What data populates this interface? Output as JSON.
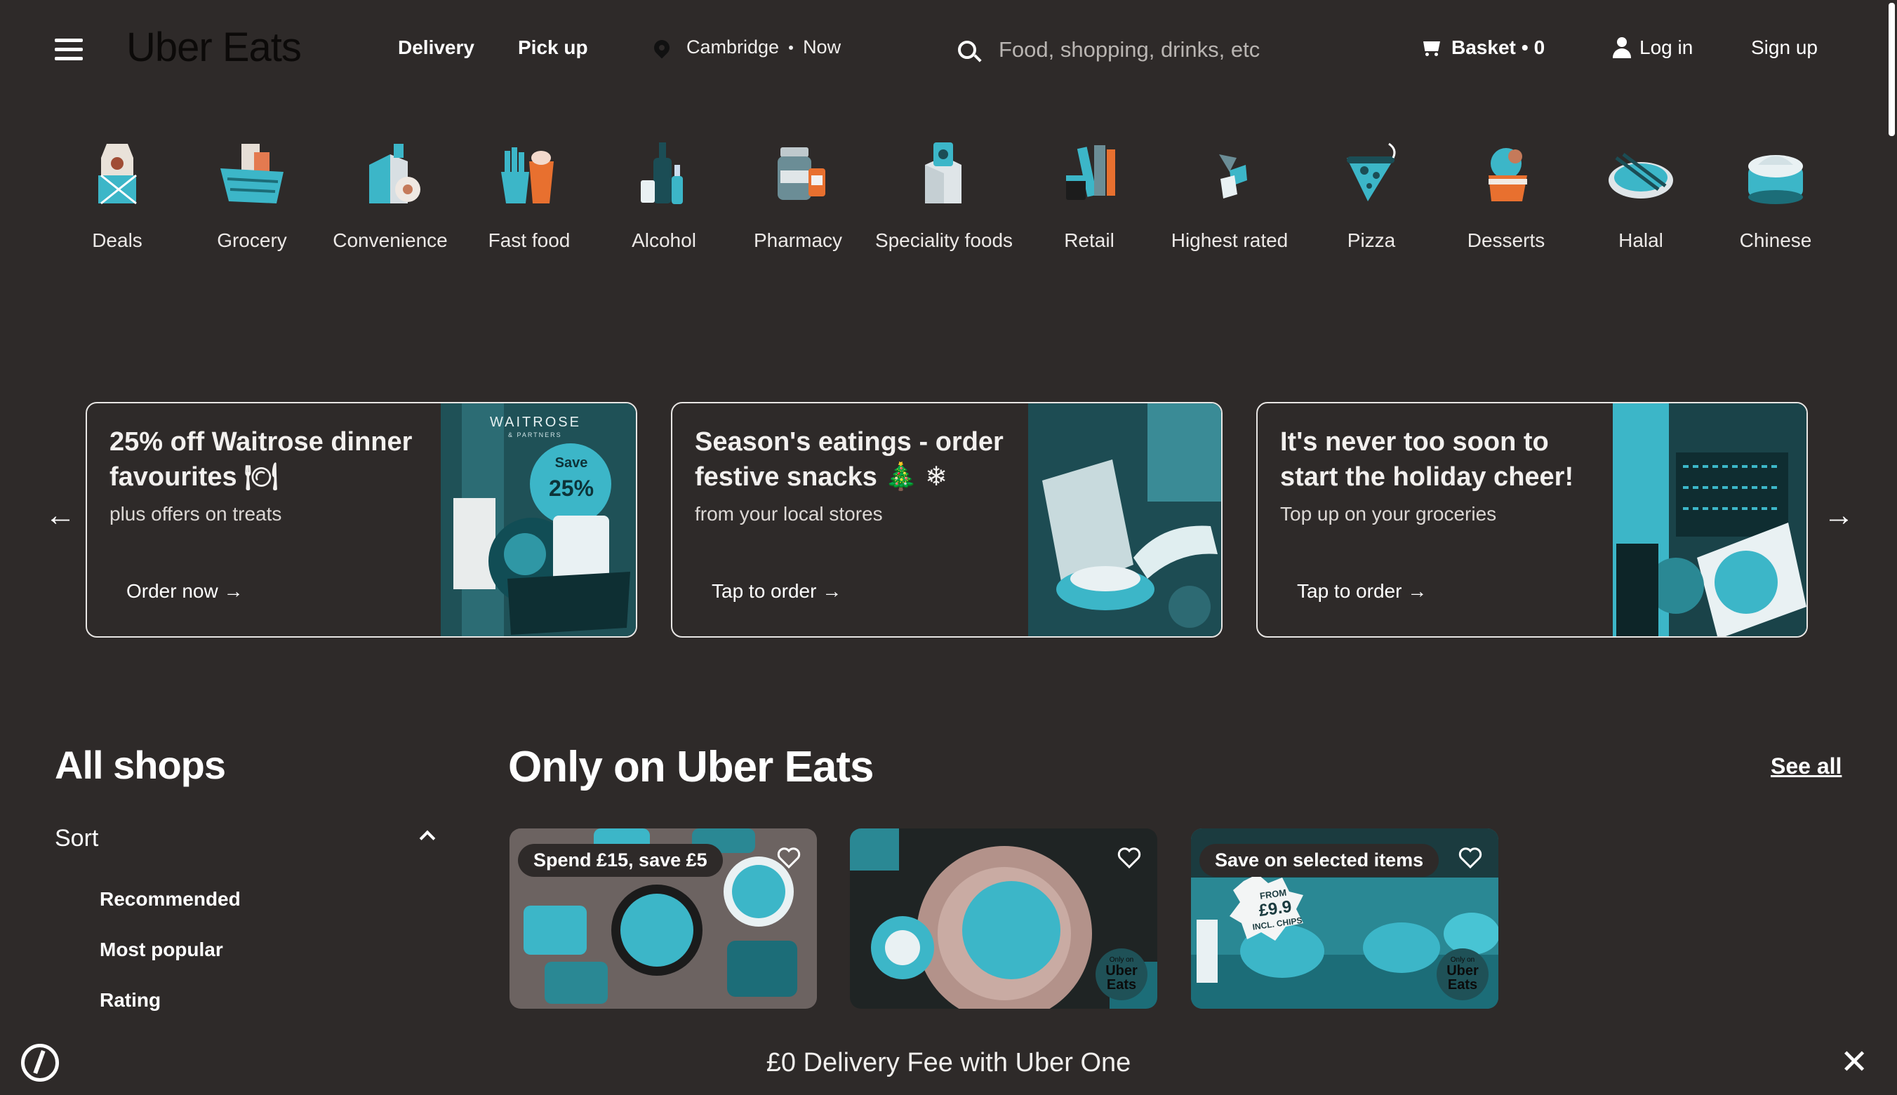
{
  "header": {
    "logo": "Uber Eats",
    "tabs": [
      "Delivery",
      "Pick up"
    ],
    "location": "Cambridge",
    "time": "Now",
    "search_placeholder": "Food, shopping, drinks, etc",
    "basket_label": "Basket",
    "basket_count": "0",
    "login": "Log in",
    "signup": "Sign up"
  },
  "categories": [
    {
      "label": "Deals",
      "icon": "deals-icon"
    },
    {
      "label": "Grocery",
      "icon": "grocery-basket-icon"
    },
    {
      "label": "Convenience",
      "icon": "convenience-icon"
    },
    {
      "label": "Fast food",
      "icon": "fast-food-icon"
    },
    {
      "label": "Alcohol",
      "icon": "alcohol-bottles-icon"
    },
    {
      "label": "Pharmacy",
      "icon": "pharmacy-icon"
    },
    {
      "label": "Speciality foods",
      "icon": "speciality-foods-icon"
    },
    {
      "label": "Retail",
      "icon": "retail-icon"
    },
    {
      "label": "Highest rated",
      "icon": "highest-rated-icon"
    },
    {
      "label": "Pizza",
      "icon": "pizza-icon"
    },
    {
      "label": "Desserts",
      "icon": "desserts-icon"
    },
    {
      "label": "Halal",
      "icon": "halal-icon"
    },
    {
      "label": "Chinese",
      "icon": "chinese-dumplings-icon"
    }
  ],
  "carousel": [
    {
      "title": "25% off Waitrose dinner favourites 🍽",
      "subtitle": "plus offers on treats",
      "button": "Order now →",
      "brand": "WAITROSE",
      "brand_sub": "& PARTNERS",
      "save_label": "Save",
      "save_value": "25%"
    },
    {
      "title": "Season's eatings - order festive snacks 🎄 ❄",
      "subtitle": "from your local stores",
      "button": "Tap to order →"
    },
    {
      "title": "It's never too soon to start the holiday cheer!",
      "subtitle": "Top up on your groceries",
      "button": "Tap to order →"
    }
  ],
  "sidebar": {
    "title": "All shops",
    "sort_label": "Sort",
    "sort_options": [
      "Recommended",
      "Most popular",
      "Rating"
    ]
  },
  "section": {
    "title": "Only on Uber Eats",
    "see_all": "See all",
    "tiles": [
      {
        "promo": "Spend £15, save £5"
      },
      {
        "promo": "",
        "badge_small": "Only on",
        "badge": "Uber Eats"
      },
      {
        "promo": "Save on selected items",
        "badge_small": "Only on",
        "badge": "Uber Eats",
        "sticker_from": "FROM",
        "sticker_price": "£9.9",
        "sticker_note": "INCL. CHIPS"
      }
    ]
  },
  "bottom_bar": {
    "text": "£0 Delivery Fee with Uber One"
  },
  "colors": {
    "background": "#2e2a29",
    "accent": "#3cb6c8",
    "text": "#ffffff"
  }
}
